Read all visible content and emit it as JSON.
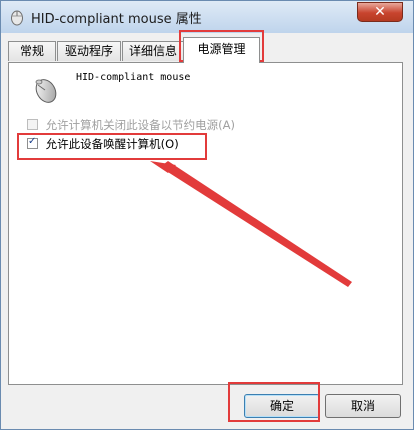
{
  "window": {
    "title": "HID-compliant mouse 属性",
    "close_glyph": "✕"
  },
  "tabs": [
    {
      "label": "常规"
    },
    {
      "label": "驱动程序"
    },
    {
      "label": "详细信息"
    },
    {
      "label": "电源管理"
    }
  ],
  "active_tab": "电源管理",
  "device": {
    "name": "HID-compliant mouse",
    "icon": "mouse-icon"
  },
  "options": [
    {
      "label": "允许计算机关闭此设备以节约电源(A)",
      "checked": false,
      "enabled": false
    },
    {
      "label": "允许此设备唤醒计算机(O)",
      "checked": true,
      "enabled": true
    }
  ],
  "buttons": {
    "ok": "确定",
    "cancel": "取消"
  },
  "annotation_colors": {
    "highlight": "#e23b3b"
  }
}
